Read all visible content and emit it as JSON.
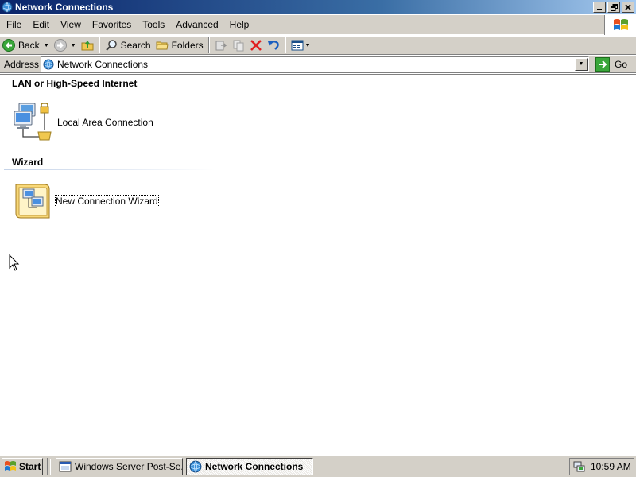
{
  "window": {
    "title": "Network Connections",
    "controls": [
      "minimize",
      "restore",
      "close"
    ]
  },
  "menu": {
    "items": [
      {
        "label": "File",
        "accel": "F"
      },
      {
        "label": "Edit",
        "accel": "E"
      },
      {
        "label": "View",
        "accel": "V"
      },
      {
        "label": "Favorites",
        "accel": "a"
      },
      {
        "label": "Tools",
        "accel": "T"
      },
      {
        "label": "Advanced",
        "accel": "n"
      },
      {
        "label": "Help",
        "accel": "H"
      }
    ]
  },
  "toolbar": {
    "back_label": "Back",
    "search_label": "Search",
    "folders_label": "Folders"
  },
  "address": {
    "label": "Address",
    "value": "Network Connections",
    "go_label": "Go"
  },
  "content": {
    "groups": [
      {
        "header": "LAN or High-Speed Internet",
        "items": [
          {
            "label": "Local Area Connection",
            "icon": "network-connection-icon"
          }
        ]
      },
      {
        "header": "Wizard",
        "items": [
          {
            "label": "New Connection Wizard",
            "icon": "wizard-icon",
            "selected": true
          }
        ]
      }
    ]
  },
  "taskbar": {
    "start_label": "Start",
    "tasks": [
      {
        "label": "Windows Server Post-Se...",
        "active": false
      },
      {
        "label": "Network Connections",
        "active": true
      }
    ],
    "clock": "10:59 AM"
  },
  "colors": {
    "titlebar_start": "#0a246a",
    "titlebar_end": "#a6caf0",
    "chrome": "#d4d0c8"
  }
}
